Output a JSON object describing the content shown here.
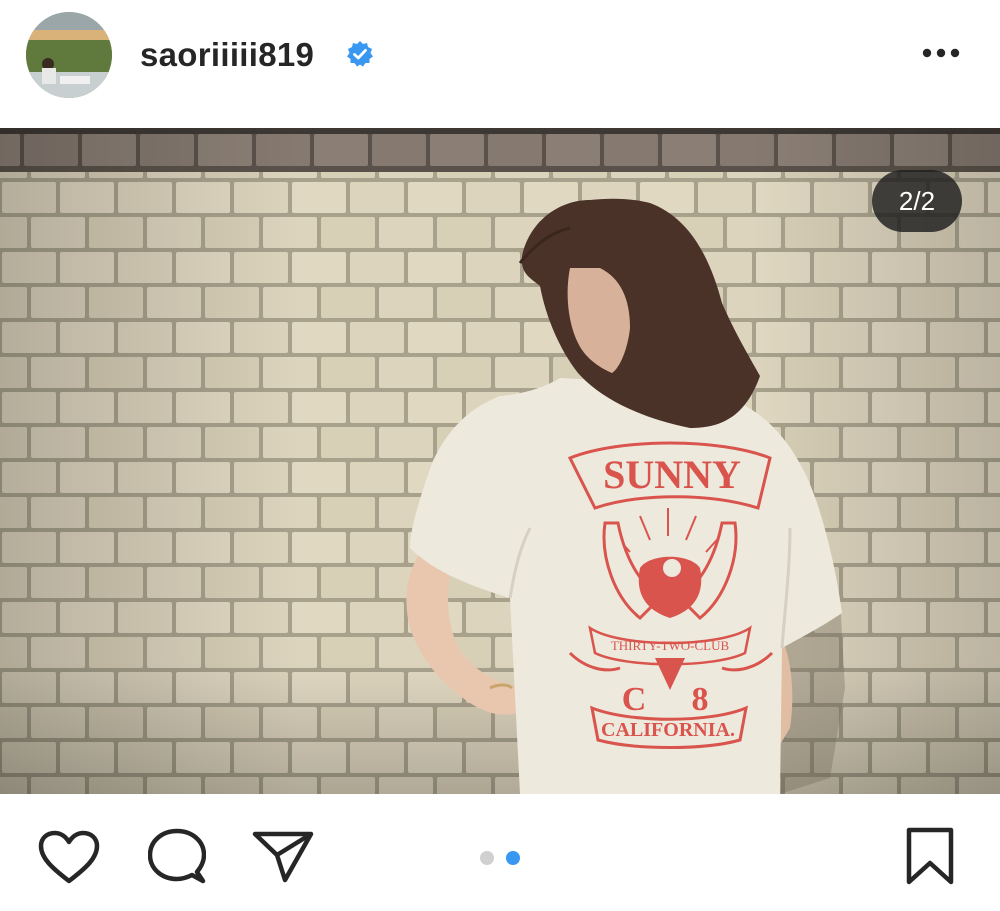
{
  "post": {
    "username": "saoriiiii819",
    "verified": true,
    "carousel_counter": "2/2",
    "carousel_total": 2,
    "carousel_active_index": 1
  },
  "shirt_print": {
    "top": "SUNNY",
    "ribbon": "THIRTY-TWO-CLUB",
    "left_letter": "C",
    "right_letter": "8",
    "bottom": "CALIFORNIA."
  },
  "icons": {
    "verified": "verified-badge-icon",
    "more": "more-options-icon",
    "like": "heart-icon",
    "comment": "comment-icon",
    "share": "send-icon",
    "save": "bookmark-icon"
  },
  "colors": {
    "verified_blue": "#3897f0",
    "active_dot": "#3897f0",
    "inactive_dot": "#d0d0d0",
    "icon": "#262626",
    "print_red": "#d9544d"
  }
}
